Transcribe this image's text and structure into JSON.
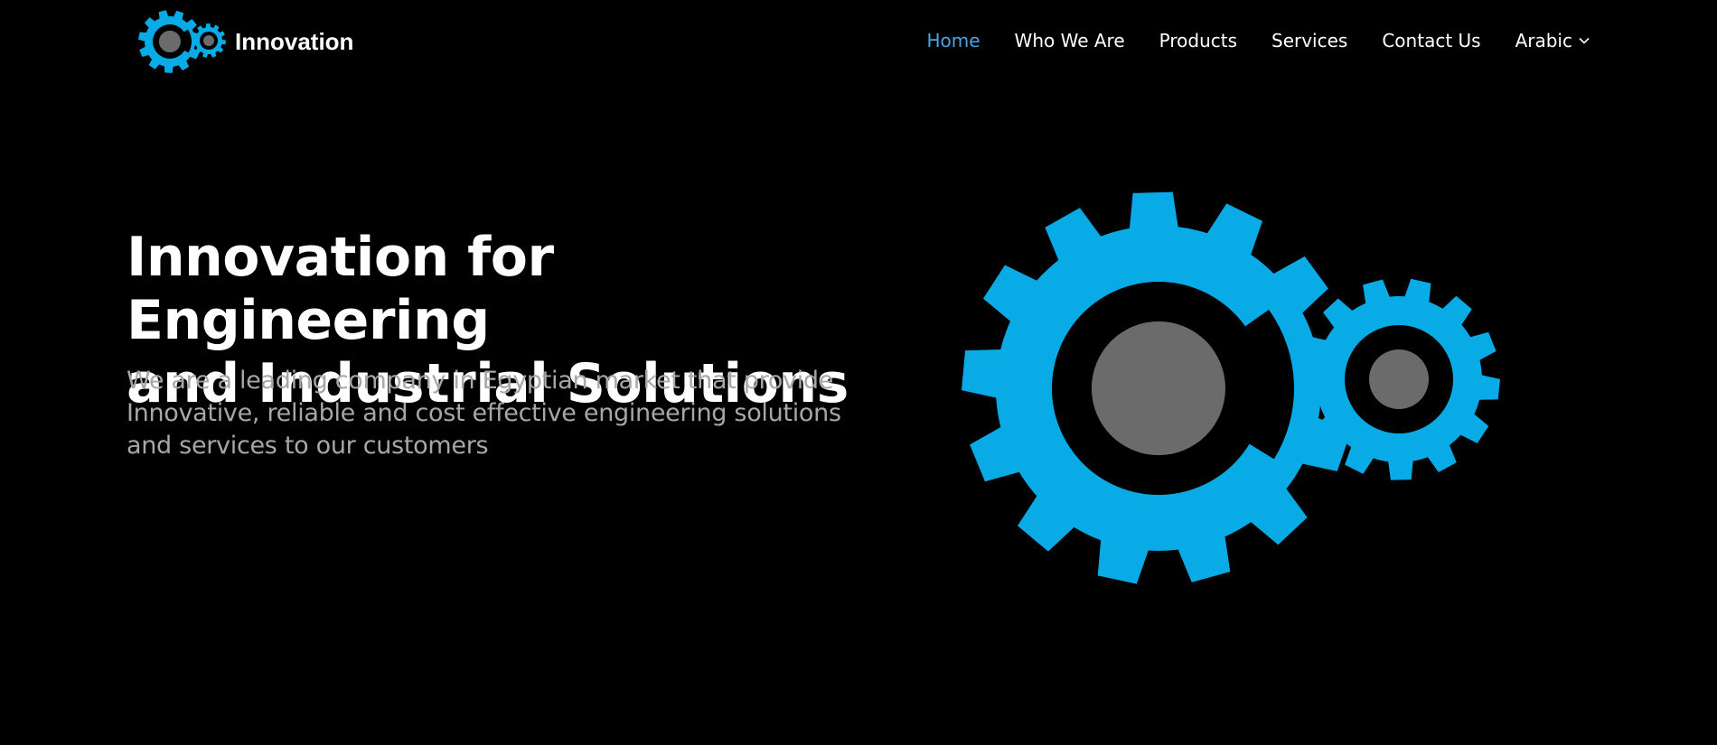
{
  "brand": {
    "name": "Innovation",
    "logo_icon": "gears-logo-icon"
  },
  "nav": {
    "items": [
      {
        "label": "Home",
        "active": true
      },
      {
        "label": "Who We Are",
        "active": false
      },
      {
        "label": "Products",
        "active": false
      },
      {
        "label": "Services",
        "active": false
      },
      {
        "label": "Contact Us",
        "active": false
      },
      {
        "label": "Arabic",
        "active": false,
        "dropdown_icon": "chevron-down-icon"
      }
    ]
  },
  "hero": {
    "title_line1": "Innovation for Engineering",
    "title_line2": "and Industrial Solutions",
    "subtitle_line1": "We are a leading company in Egyptian market that provide",
    "subtitle_line2": "Innovative, reliable and cost effective engineering solutions",
    "subtitle_line3": "and services to our customers",
    "illustration_icon": "gears-illustration-icon"
  },
  "colors": {
    "background": "#000000",
    "accent_blue": "#08abe6",
    "gear_center_gray": "#6b6b6b",
    "nav_active": "#4fa3e0",
    "subtitle_gray": "#a7a7a7",
    "text_white": "#ffffff"
  }
}
